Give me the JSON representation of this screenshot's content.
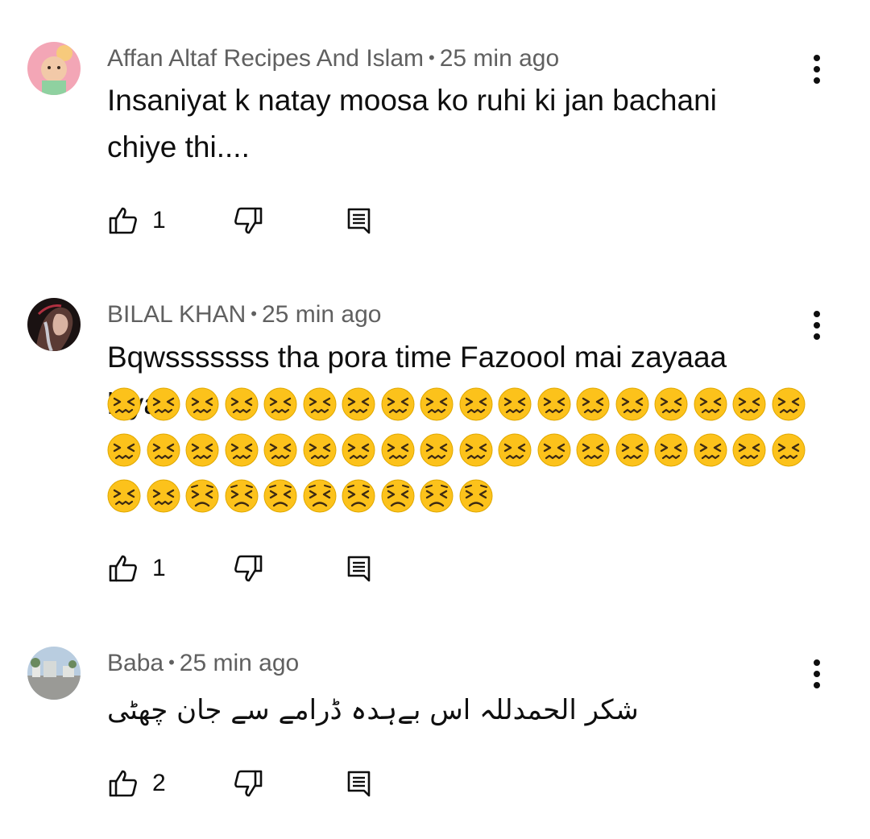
{
  "comments": [
    {
      "author": "Affan Altaf Recipes And Islam",
      "separator": "•",
      "time": "25 min ago",
      "text_line1": "Insaniyat k natay moosa ko ruhi ki jan bachani",
      "text_line2": "chiye thi....",
      "likes": "1"
    },
    {
      "author": "BILAL KHAN",
      "separator": "•",
      "time": "25 min ago",
      "text_line1": "Bqwsssssss tha pora time Fazoool mai zayaaa",
      "text_line2": "kiya",
      "emoji_sequence": {
        "confounded_face_count": 38,
        "persevering_face_count": 8
      },
      "likes": "1"
    },
    {
      "author": "Baba",
      "separator": "•",
      "time": "25 min ago",
      "text_line1": "شکر الحمدللہ اس بےہدہ ڈرامے سے جان چھٹی",
      "likes": "2"
    }
  ],
  "icons": {
    "like": "thumbs-up-icon",
    "dislike": "thumbs-down-icon",
    "reply": "reply-icon",
    "more": "more-vertical-icon",
    "emoji_a": "confounded-face-emoji",
    "emoji_b": "persevering-face-emoji"
  },
  "colors": {
    "meta_text": "#606060",
    "body_text": "#0f0f0f",
    "emoji_yellow": "#fcc21b"
  }
}
